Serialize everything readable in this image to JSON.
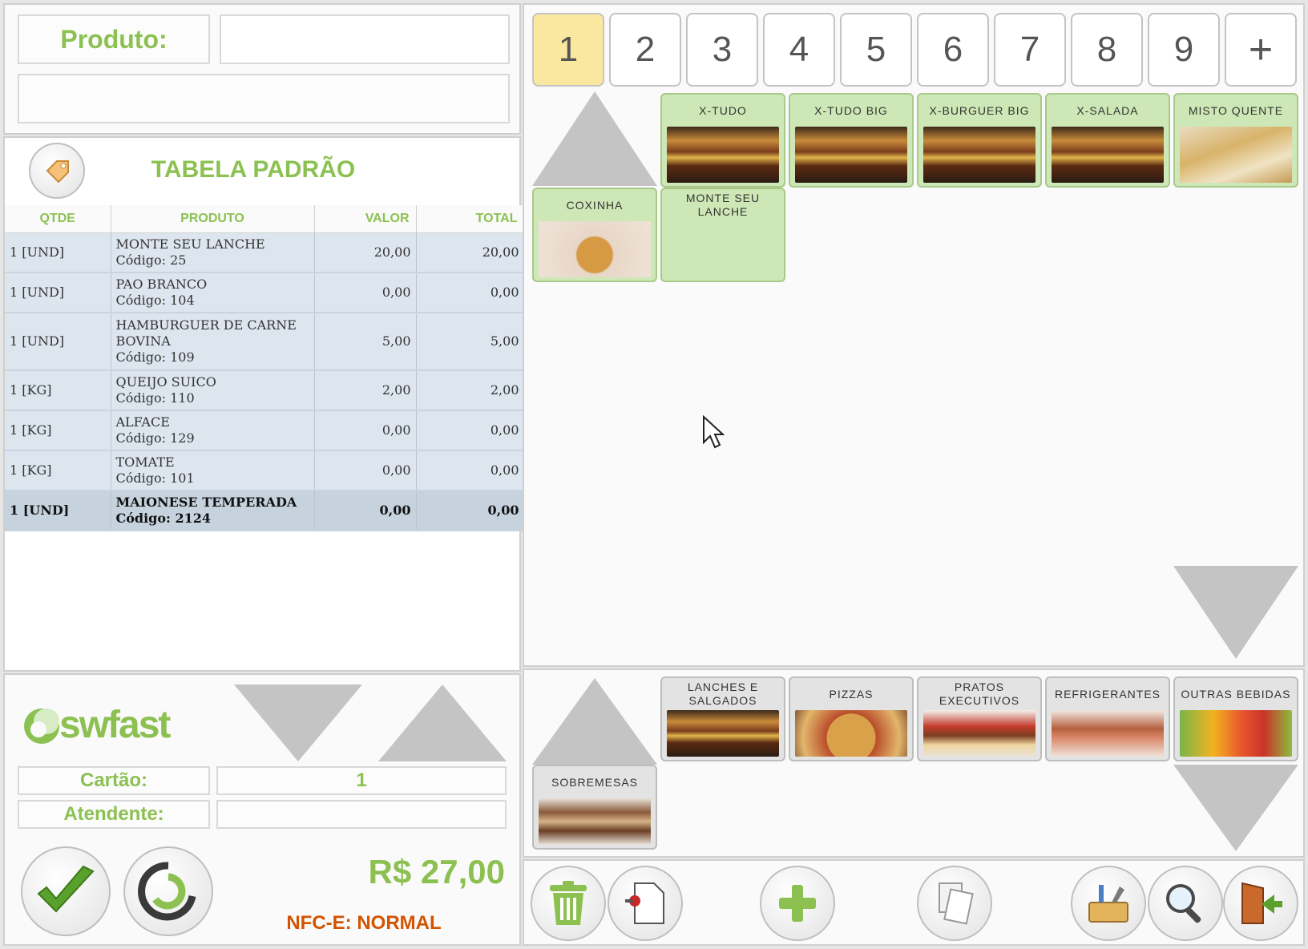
{
  "left": {
    "produto_label": "Produto:",
    "produto_value": "",
    "produto_desc": "",
    "tabela_title": "TABELA PADRÃO",
    "columns": [
      "QTDE",
      "PRODUTO",
      "VALOR",
      "TOTAL"
    ],
    "items": [
      {
        "qtde": "1 [UND]",
        "name": "MONTE SEU LANCHE",
        "code": "Código: 25",
        "valor": "20,00",
        "total": "20,00"
      },
      {
        "qtde": "1 [UND]",
        "name": "PAO BRANCO",
        "code": "Código: 104",
        "valor": "0,00",
        "total": "0,00"
      },
      {
        "qtde": "1 [UND]",
        "name": "HAMBURGUER DE CARNE BOVINA",
        "code": "Código: 109",
        "valor": "5,00",
        "total": "5,00"
      },
      {
        "qtde": "1 [KG]",
        "name": "QUEIJO SUICO",
        "code": "Código: 110",
        "valor": "2,00",
        "total": "2,00"
      },
      {
        "qtde": "1 [KG]",
        "name": "ALFACE",
        "code": "Código: 129",
        "valor": "0,00",
        "total": "0,00"
      },
      {
        "qtde": "1 [KG]",
        "name": "TOMATE",
        "code": "Código: 101",
        "valor": "0,00",
        "total": "0,00"
      },
      {
        "qtde": "1 [UND]",
        "name": "MAIONESE TEMPERADA",
        "code": "Código: 2124",
        "valor": "0,00",
        "total": "0,00"
      }
    ],
    "brand": "swfast",
    "cartao_label": "Cartão:",
    "cartao_value": "1",
    "atendente_label": "Atendente:",
    "atendente_value": "",
    "total": "R$ 27,00",
    "nfce_status": "NFC-E: NORMAL"
  },
  "tabs": [
    "1",
    "2",
    "3",
    "4",
    "5",
    "6",
    "7",
    "8",
    "9",
    "+"
  ],
  "products": [
    {
      "label": "X-TUDO",
      "img": "burger"
    },
    {
      "label": "X-TUDO BIG",
      "img": "burger"
    },
    {
      "label": "X-BURGUER BIG",
      "img": "burger"
    },
    {
      "label": "X-SALADA",
      "img": "burger"
    },
    {
      "label": "MISTO QUENTE",
      "img": "sandw"
    },
    {
      "label": "COXINHA",
      "img": "cox"
    },
    {
      "label": "MONTE SEU LANCHE",
      "img": ""
    }
  ],
  "categories": [
    {
      "label": "LANCHES E SALGADOS",
      "img": "burger"
    },
    {
      "label": "PIZZAS",
      "img": "pizza"
    },
    {
      "label": "PRATOS EXECUTIVOS",
      "img": "prato"
    },
    {
      "label": "REFRIGERANTES",
      "img": "refri"
    },
    {
      "label": "OUTRAS BEBIDAS",
      "img": "bebida"
    },
    {
      "label": "SOBREMESAS",
      "img": "doce"
    }
  ],
  "colors": {
    "accent_green": "#8cc152",
    "active_tab": "#fbe8a0",
    "nfce": "#d35400"
  }
}
